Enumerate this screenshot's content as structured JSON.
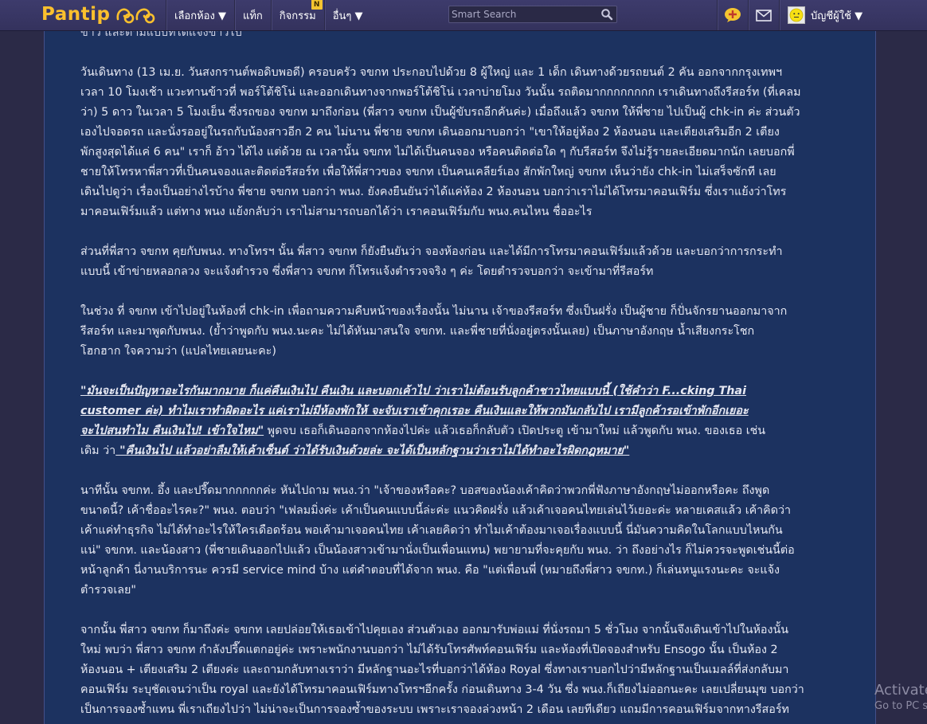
{
  "navbar": {
    "logo_text": "Pantip",
    "menu": [
      {
        "label": "เลือกห้อง ▼"
      },
      {
        "label": "แท็ก"
      },
      {
        "label": "กิจกรรม",
        "badge": "N"
      },
      {
        "label": "อื่นๆ ▼"
      }
    ],
    "search_placeholder": "Smart Search",
    "account_label": "บัญชีผู้ใช้ ▼",
    "icons": [
      "search-icon",
      "add-topic-icon",
      "mail-icon",
      "avatar-icon"
    ]
  },
  "colors": {
    "navbar_bg": "#3a3866",
    "panel_bg": "#1c3260",
    "logo": "#fbc02d",
    "text": "#e6e8f2",
    "badge": "#f4c430"
  },
  "story": {
    "top_clipped": "ข่าว และตามแบบที่ได้แจ้งข่าวไป",
    "p1": [
      "วันเดินทาง (13 เม.ย. วันสงกรานต์พอดิบพอดี) ครอบครัว จขกท ประกอบไปด้วย 8 ผู้ใหญ่ และ 1 เด็ก เดินทางด้วยรถยนต์ 2 คัน  ออกจากกรุงเทพฯ",
      "เวลา 10 โมงเช้า แวะทานข้าวที่ พอร์โต้ชิโน่ และออกเดินทางจากพอร์โต้ชิโน่ เวลาบ่ายโมง วันนั้น รถติดมากกกกกกกก เราเดินทางถึงรีสอร์ท (ที่เคลม",
      "ว่า) 5 ดาว ในเวลา 5 โมงเย็น  ซึ่งรถของ จขกท มาถึงก่อน (พี่สาว จขกท เป็นผู้ขับรถอีกคันค่ะ) เมื่อถึงแล้ว จขกท ให้พี่ชาย ไปเป็นผู้ chk-in ค่ะ ส่วนตัว",
      "เองไปจอดรถ และนั่งรออยู่ในรถกับน้องสาวอีก 2 คน  ไม่นาน พี่ชาย จขกท เดินออกมาบอกว่า \"เขาให้อยู่ห้อง 2 ห้องนอน และเตียงเสริมอีก 2 เตียง",
      "พักสูงสุดได้แค่ 6 คน\" เราก็ อ้าว ได้ไง แต่ด้วย ณ เวลานั้น จขกท ไม่ได้เป็นคนจอง หรือคนติดต่อใด ๆ กับรีสอร์ท จึงไม่รู้รายละเอียดมากนัก เลยบอกพี่",
      "ชายให้โทรหาพี่สาวที่เป็นคนจองและติดต่อรีสอร์ท เพื่อให้พี่สาวของ จขกท เป็นคนเคลียร์เอง  สักพักใหญ่ จขกท เห็นว่ายัง chk-in ไม่เสร็จซักที เลย",
      "เดินไปดูว่า เรื่องเป็นอย่างไรบ้าง พี่ชาย จขกท บอกว่า พนง. ยังคงยืนยันว่าได้แค่ห้อง 2 ห้องนอน บอกว่าเราไม่ได้โทรมาคอนเฟิร์ม  ซึ่งเราแย้งว่าโทร",
      "มาคอนเฟิร์มแล้ว แต่ทาง พนง แย้งกลับว่า เราไม่สามารถบอกได้ว่า เราคอนเฟิร์มกับ พนง.คนไหน  ชื่ออะไร"
    ],
    "p2": [
      "ส่วนที่พี่สาว จขกท คุยกับพนง. ทางโทรฯ นั้น  พี่สาว จขกท ก็ยังยืนยันว่า จองห้องก่อน และได้มีการโทรมาคอนเฟิร์มแล้วด้วย และบอกว่าการกระทำ",
      "แบบนี้ เข้าข่ายหลอกลวง จะแจ้งตำรวจ  ซึ่งพี่สาว จขกท ก็โทรแจ้งตำรวจจริง ๆ ค่ะ  โดยตำรวจบอกว่า จะเข้ามาที่รีสอร์ท"
    ],
    "p3": [
      "ในช่วง ที่ จขกท เข้าไปอยู่ในห้องที่ chk-in เพื่อถามความคืบหน้าของเรื่องนั้น ไม่นาน เจ้าของรีสอร์ท ซึ่งเป็นฝรั่ง เป็นผู้ชาย  ก็ปั่นจักรยานออกมาจาก",
      "รีสอร์ท และมาพูดกับพนง. (ย้ำว่าพูดกับ พนง.นะคะ ไม่ได้หันมาสนใจ จขกท. และพี่ชายที่นั่งอยู่ตรงนั้นเลย)  เป็นภาษาอังกฤษ น้ำเสียงกระโชก",
      "โฮกฮาก ใจความว่า (แปลไทยเลยนะคะ)"
    ],
    "p4_q1_line1": "\"มันจะเป็นปัญหาอะไรกันมากมาย ก็แค่คืนเงินไป คืนเงิน และบอกเค้าไป ว่าเราไม่ต้อนรับลูกค้าชาวไทยแบบนี้ (ใช้คำว่า F...cking Thai",
    "p4_q1_line2": "customer ค่ะ) ทำไมเราทำผิดอะไร แค่เราไม่มีห้องพักให้ จะจับเราเข้าคุกเรอะ คืนเงินและให้พวกมันกลับไป  เรามีลูกค้ารอเข้าพักอีกเยอะ",
    "p4_q1_line3": "จะไปสนทำไม  คืนเงินไป! เข้าใจไหม\"",
    "p4_text1": " พูดจบ เธอก็เดินออกจากห้องไปค่ะ  แล้วเธอก็กลับตัว เปิดประตู เข้ามาใหม่ แล้วพูดกับ พนง. ของเธอ เช่น",
    "p4_text2": "เดิม ว่า",
    "p4_q2": " \"คืนเงินไป แล้วอย่าลืมให้เค้าเซ็นต์ ว่าได้รับเงินด้วยล่ะ จะได้เป็นหลักฐานว่าเราไม่ได้ทำอะไรผิดกฎหมาย\"",
    "p5": [
      "นาทีนั้น  จขกท. อึ้ง และปรี๊ดมากกกกกค่ะ  หันไปถาม พนง.ว่า \"เจ้าของหรือคะ? บอสของน้องเค้าคิดว่าพวกพี่ฟังภาษาอังกฤษไม่ออกหรือคะ ถึงพูด",
      "ขนาดนี้? เค้าชื่ออะไรคะ?\"  พนง. ตอบว่า \"เฟลมมิ่งค่ะ  เค้าเป็นคนแบบนี้ล่ะค่ะ แนวคิดฝรั่ง แล้วเค้าเจอคนไทยเล่นไว้เยอะค่ะ หลายเคสแล้ว  เค้าคิดว่า",
      "เค้าแค่ทำธุรกิจ ไม่ได้ทำอะไรให้ใครเดือดร้อน พอเค้ามาเจอคนไทย เค้าเลยคิดว่า ทำไมเค้าต้องมาเจอเรื่องแบบนี้  นี่มันความคิดในโลกแบบไหนกัน",
      "แน่\"  จขกท. และน้องสาว (พี่ชายเดินออกไปแล้ว เป็นน้องสาวเข้ามานั่งเป็นเพื่อนแทน)  พยายามที่จะคุยกับ พนง. ว่า ถึงอย่างไร ก็ไม่ควรจะพูดเช่นนี้ต่อ",
      "หน้าลูกค้า นี่งานบริการนะ ควรมี service mind บ้าง  แต่คำตอบที่ได้จาก พนง. คือ \"แต่เพื่อนพี่ (หมายถึงพี่สาว จขกท.) ก็เล่นหนูแรงนะคะ จะแจ้ง",
      "ตำรวจเลย\""
    ],
    "p6": [
      "จากนั้น พี่สาว จขกท ก็มาถึงค่ะ จขกท เลยปล่อยให้เธอเข้าไปคุยเอง ส่วนตัวเอง ออกมารับพ่อแม่ ที่นั่งรถมา 5 ชั่วโมง  จากนั้นจึงเดินเข้าไปในห้องนั้น",
      "ใหม่ พบว่า พี่สาว จขกท กำลังปรี๊ดแตกอยู่ค่ะ  เพราะพนักงานบอกว่า ไม่ได้รับโทรศัพท์คอนเฟิร์ม และห้องที่เปิดจองสำหรับ Ensogo นั้น เป็นห้อง 2",
      "ห้องนอน + เตียงเสริม 2 เตียงค่ะ  และถามกลับทางเราว่า มีหลักฐานอะไรที่บอกว่าได้ห้อง Royal ซึ่งทางเราบอกไปว่ามีหลักฐานเป็นเมลล์ที่ส่งกลับมา",
      "คอนเฟิร์ม ระบุชัดเจนว่าเป็น royal และยังได้โทรมาคอนเฟิร์มทางโทรฯอีกครั้ง ก่อนเดินทาง 3-4 วัน ซึ่ง พนง.ก็เถียงไม่ออกนะคะ เลยเปลี่ยนมุข บอกว่า",
      "เป็นการจองซ้ำแทน  พี่เราเถียงไปว่า ไม่น่าจะเป็นการจองซ้ำของระบบ เพราะเราจองล่วงหน้า 2 เดือน เลยทีเดียว แถมมีการคอนเฟิร์มจากทางรีสอร์ท"
    ]
  },
  "watermark": {
    "line1": "Activate",
    "line2": "Go to PC s"
  }
}
